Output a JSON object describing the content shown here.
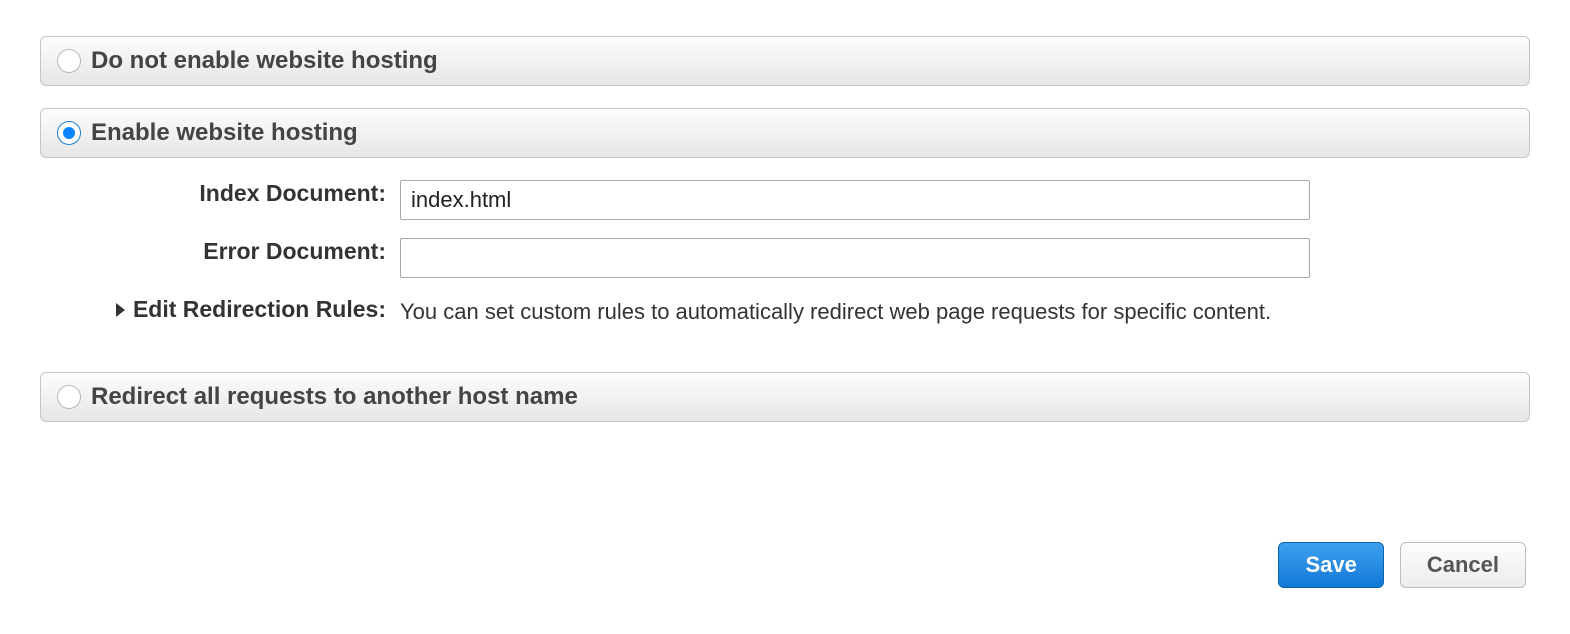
{
  "options": {
    "do_not_enable": {
      "label": "Do not enable website hosting",
      "selected": false
    },
    "enable": {
      "label": "Enable website hosting",
      "selected": true
    },
    "redirect_all": {
      "label": "Redirect all requests to another host name",
      "selected": false
    }
  },
  "form": {
    "index_document": {
      "label": "Index Document:",
      "value": "index.html"
    },
    "error_document": {
      "label": "Error Document:",
      "value": ""
    },
    "redirection_rules": {
      "label": "Edit Redirection Rules:",
      "helper": "You can set custom rules to automatically redirect web page requests for specific content."
    }
  },
  "buttons": {
    "save": "Save",
    "cancel": "Cancel"
  }
}
